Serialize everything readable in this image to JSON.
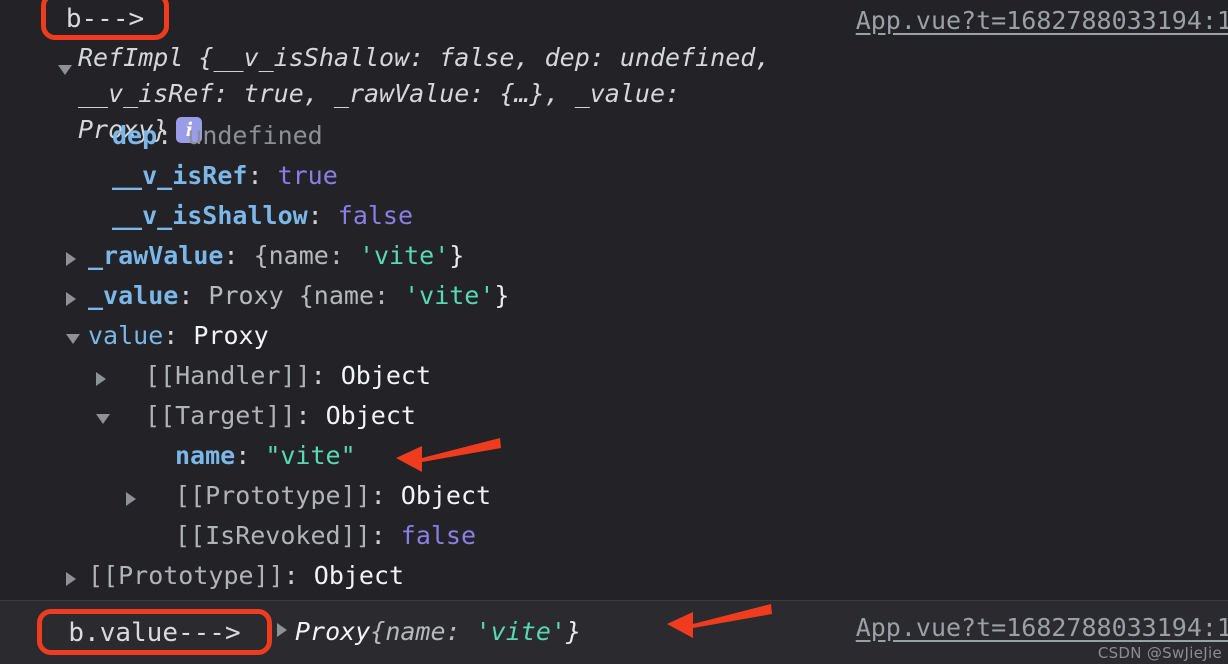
{
  "console": {
    "background_color": "#232327",
    "message": {
      "source_link": "App.vue?t=1682788033194:1",
      "preview_line1": "RefImpl {__v_isShallow: false, dep: undefined, __v_isRef: true, _",
      "preview_line2": "rawValue: {…}, _value: Proxy}",
      "info_badge": "i"
    },
    "properties": [
      {
        "name": "dep",
        "separator": ":",
        "value": "undefined",
        "value_kind": "undefined",
        "name_kind": "own",
        "toggle": "none",
        "indent": "ind1"
      },
      {
        "name": "__v_isRef",
        "separator": ":",
        "value": "true",
        "value_kind": "boolean",
        "name_kind": "own",
        "toggle": "none",
        "indent": "ind1"
      },
      {
        "name": "__v_isShallow",
        "separator": ":",
        "value": "false",
        "value_kind": "boolean",
        "name_kind": "own",
        "toggle": "none",
        "indent": "ind1"
      },
      {
        "name": "_rawValue",
        "separator": ":",
        "value": "{name: 'vite'}",
        "value_kind": "objpreview",
        "name_kind": "own",
        "toggle": "closed",
        "indent": "ind1b"
      },
      {
        "name": "_value",
        "separator": ":",
        "value": "Proxy {name: 'vite'}",
        "value_kind": "objpreview",
        "name_kind": "own",
        "toggle": "closed",
        "indent": "ind1b"
      },
      {
        "name": "value",
        "separator": ":",
        "value": "Proxy",
        "value_kind": "object",
        "name_kind": "getter",
        "toggle": "open",
        "indent": "ind1b"
      },
      {
        "name": "[[Handler]]",
        "separator": ":",
        "value": "Object",
        "value_kind": "object",
        "name_kind": "internal",
        "toggle": "closed",
        "indent": "ind2"
      },
      {
        "name": "[[Target]]",
        "separator": ":",
        "value": "Object",
        "value_kind": "object",
        "name_kind": "internal",
        "toggle": "open",
        "indent": "ind2"
      },
      {
        "name": "name",
        "separator": ":",
        "value": "\"vite\"",
        "value_kind": "string",
        "name_kind": "own",
        "toggle": "none",
        "indent": "ind3"
      },
      {
        "name": "[[Prototype]]",
        "separator": ":",
        "value": "Object",
        "value_kind": "object",
        "name_kind": "internal",
        "toggle": "closed",
        "indent": "ind3"
      },
      {
        "name": "[[IsRevoked]]",
        "separator": ":",
        "value": "false",
        "value_kind": "boolean",
        "name_kind": "internal",
        "toggle": "none",
        "indent": "ind3"
      },
      {
        "name": "[[Prototype]]",
        "separator": ":",
        "value": "Object",
        "value_kind": "object",
        "name_kind": "internal",
        "toggle": "closed",
        "indent": "ind1b"
      }
    ],
    "result": {
      "preview": "Proxy {name: 'vite'}",
      "preview_class": "Proxy",
      "preview_prop": "{name: ",
      "preview_string": "'vite'",
      "preview_close": "}",
      "source_link": "App.vue?t=1682788033194:1"
    }
  },
  "annotations": {
    "label_b": "b--->",
    "label_b_value": "b.value--->",
    "accent_color": "#f03c1e",
    "arrow_to_name": "arrow-pointing-left-at-name-vite",
    "arrow_to_proxy": "arrow-pointing-left-at-proxy-result"
  },
  "watermark": {
    "text": "CSDN @SwJieJie"
  }
}
